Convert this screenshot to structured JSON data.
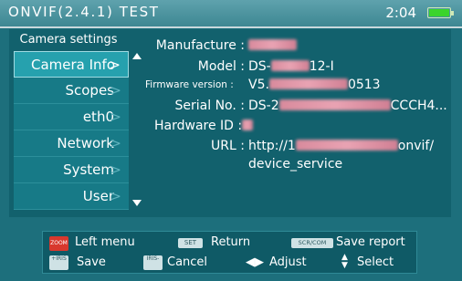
{
  "header": {
    "title": "ONVIF(2.4.1)  TEST",
    "time": "2:04"
  },
  "sidebar": {
    "heading": "Camera settings",
    "items": [
      {
        "label": "Camera Info",
        "active": true
      },
      {
        "label": "Scopes",
        "active": false
      },
      {
        "label": "eth0",
        "active": false
      },
      {
        "label": "Network",
        "active": false
      },
      {
        "label": "System",
        "active": false
      },
      {
        "label": "User",
        "active": false
      }
    ],
    "chevron": ">"
  },
  "info": {
    "manufacture_label": "Manufacture :",
    "model_label": "Model :",
    "model_prefix": "DS-",
    "model_suffix": "12-I",
    "firmware_label": "Firmware version :",
    "firmware_prefix": "V5.",
    "firmware_suffix": "0513",
    "serial_label": "Serial No. :",
    "serial_prefix": "DS-2",
    "serial_suffix": "CCCH4...",
    "hardware_label": "Hardware ID :",
    "url_label": "URL :",
    "url_prefix": "http://1",
    "url_suffix": "onvif/",
    "url_line2": "device_service"
  },
  "footer": {
    "left_menu": "Left menu",
    "return": "Return",
    "save_report": "Save report",
    "save": "Save",
    "cancel": "Cancel",
    "adjust": "Adjust",
    "select": "Select",
    "key_zoom": "ZOOM",
    "key_set": "SET",
    "key_scr": "SCR/COM",
    "key_iris_plus": "+IRIS",
    "key_iris_minus": "IRIS-"
  },
  "colors": {
    "background": "#1d6f7c",
    "panel": "#12616d",
    "menu_active": "#26a1ae",
    "battery": "#3bd42c",
    "redacted": "#e9a3b3"
  }
}
